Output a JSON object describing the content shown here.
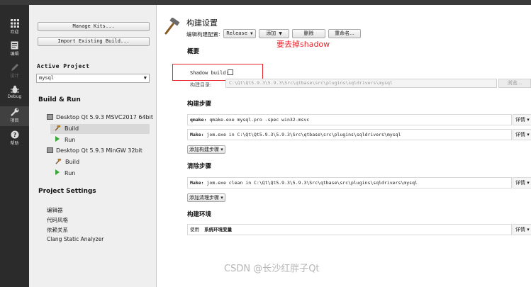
{
  "mode_bar": {
    "items": [
      {
        "label": "欢迎",
        "icon": "grid-icon"
      },
      {
        "label": "编辑",
        "icon": "document-icon"
      },
      {
        "label": "设计",
        "icon": "pencil-icon"
      },
      {
        "label": "Debug",
        "icon": "bug-icon"
      },
      {
        "label": "项目",
        "icon": "wrench-icon"
      },
      {
        "label": "帮助",
        "icon": "help-icon"
      }
    ]
  },
  "left_panel": {
    "manage_kits": "Manage Kits...",
    "import_build": "Import Existing Build...",
    "active_project_label": "Active Project",
    "active_project_value": "mysql",
    "build_run_label": "Build & Run",
    "kits": [
      {
        "name": "Desktop Qt 5.9.3 MSVC2017 64bit",
        "build": "Build",
        "run": "Run"
      },
      {
        "name": "Desktop Qt 5.9.3 MinGW 32bit",
        "build": "Build",
        "run": "Run"
      }
    ],
    "project_settings_label": "Project Settings",
    "settings_items": [
      "编辑器",
      "代码风格",
      "依赖关系",
      "Clang Static Analyzer"
    ]
  },
  "main": {
    "title": "构建设置",
    "edit_config_label": "编辑构建配置:",
    "config_value": "Release",
    "add_label": "添加",
    "delete_label": "删除",
    "rename_label": "重命名...",
    "overview_label": "概要",
    "annotation": "要去掉shadow",
    "shadow_build_label": "Shadow build:",
    "build_dir_label": "构建目录:",
    "build_dir_value": "C:\\Qt\\Qt5.9.3\\5.9.3\\Src\\qtbase\\src\\plugins\\sqldrivers\\mysql",
    "browse_label": "浏览...",
    "build_steps_label": "构建步骤",
    "build_steps": [
      {
        "tool": "qmake:",
        "command": " qmake.exe mysql.pro -spec win32-msvc",
        "detail": "详情 ▾"
      },
      {
        "tool": "Make:",
        "command": " jom.exe in C:\\Qt\\Qt5.9.3\\5.9.3\\Src\\qtbase\\src\\plugins\\sqldrivers\\mysql",
        "detail": "详情 ▾"
      }
    ],
    "add_build_step": "添加构建步骤 ▾",
    "clean_steps_label": "清除步骤",
    "clean_steps": [
      {
        "tool": "Make:",
        "command": " jom.exe clean in C:\\Qt\\Qt5.9.3\\5.9.3\\Src\\qtbase\\src\\plugins\\sqldrivers\\mysql",
        "detail": "详情 ▾"
      }
    ],
    "add_clean_step": "添加清理步骤 ▾",
    "build_env_label": "构建环境",
    "env_use": "使用",
    "env_value": "系统环境变量",
    "env_detail": "详情 ▾"
  },
  "watermark": "CSDN @长沙红胖子Qt",
  "colors": {
    "mode_bar_bg": "#2b2b2b",
    "left_panel_bg": "#efefef",
    "annotation_red": "#e8232a",
    "run_green": "#3aa63a"
  }
}
